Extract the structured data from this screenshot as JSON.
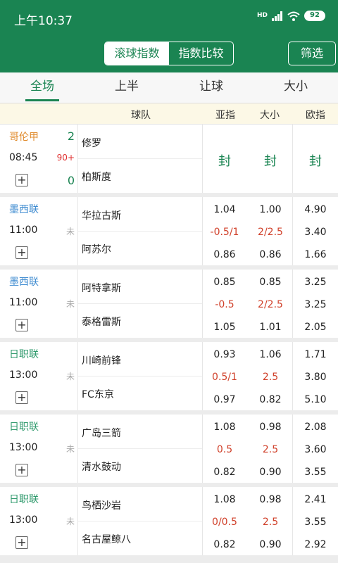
{
  "status_bar": {
    "time": "上午10:37",
    "network": "HD",
    "battery": "92"
  },
  "header": {
    "segments": [
      "滚球指数",
      "指数比较"
    ],
    "filter_label": "筛选"
  },
  "tabs": [
    "全场",
    "上半",
    "让球",
    "大小"
  ],
  "columns": {
    "team": "球队",
    "asian": "亚指",
    "ou": "大小",
    "euro": "欧指"
  },
  "sealed_label": "封",
  "plus_label": "+",
  "matches": [
    {
      "league": "哥伦甲",
      "league_color": "#e08a2b",
      "time": "08:45",
      "status": "90+",
      "home_score": "2",
      "away_score": "0",
      "home": "修罗",
      "away": "柏斯度",
      "sealed": true
    },
    {
      "league": "墨西联",
      "league_color": "#3e8bd0",
      "time": "11:00",
      "status": "未",
      "home": "华拉古斯",
      "away": "阿苏尔",
      "asian": [
        "1.04",
        "-0.5/1",
        "0.86"
      ],
      "ou": [
        "1.00",
        "2/2.5",
        "0.86"
      ],
      "euro": [
        "4.90",
        "3.40",
        "1.66"
      ]
    },
    {
      "league": "墨西联",
      "league_color": "#3e8bd0",
      "time": "11:00",
      "status": "未",
      "home": "阿特拿斯",
      "away": "泰格雷斯",
      "asian": [
        "0.85",
        "-0.5",
        "1.05"
      ],
      "ou": [
        "0.85",
        "2/2.5",
        "1.01"
      ],
      "euro": [
        "3.25",
        "3.25",
        "2.05"
      ]
    },
    {
      "league": "日职联",
      "league_color": "#2f9a6c",
      "time": "13:00",
      "status": "未",
      "home": "川崎前锋",
      "away": "FC东京",
      "asian": [
        "0.93",
        "0.5/1",
        "0.97"
      ],
      "ou": [
        "1.06",
        "2.5",
        "0.82"
      ],
      "euro": [
        "1.71",
        "3.80",
        "5.10"
      ]
    },
    {
      "league": "日职联",
      "league_color": "#2f9a6c",
      "time": "13:00",
      "status": "未",
      "home": "广岛三箭",
      "away": "清水鼓动",
      "asian": [
        "1.08",
        "0.5",
        "0.82"
      ],
      "ou": [
        "0.98",
        "2.5",
        "0.90"
      ],
      "euro": [
        "2.08",
        "3.60",
        "3.55"
      ]
    },
    {
      "league": "日职联",
      "league_color": "#2f9a6c",
      "time": "13:00",
      "status": "未",
      "home": "鸟栖沙岩",
      "away": "名古屋鲸八",
      "asian": [
        "1.08",
        "0/0.5",
        "0.82"
      ],
      "ou": [
        "0.98",
        "2.5",
        "0.90"
      ],
      "euro": [
        "2.41",
        "3.55",
        "2.92"
      ]
    }
  ]
}
